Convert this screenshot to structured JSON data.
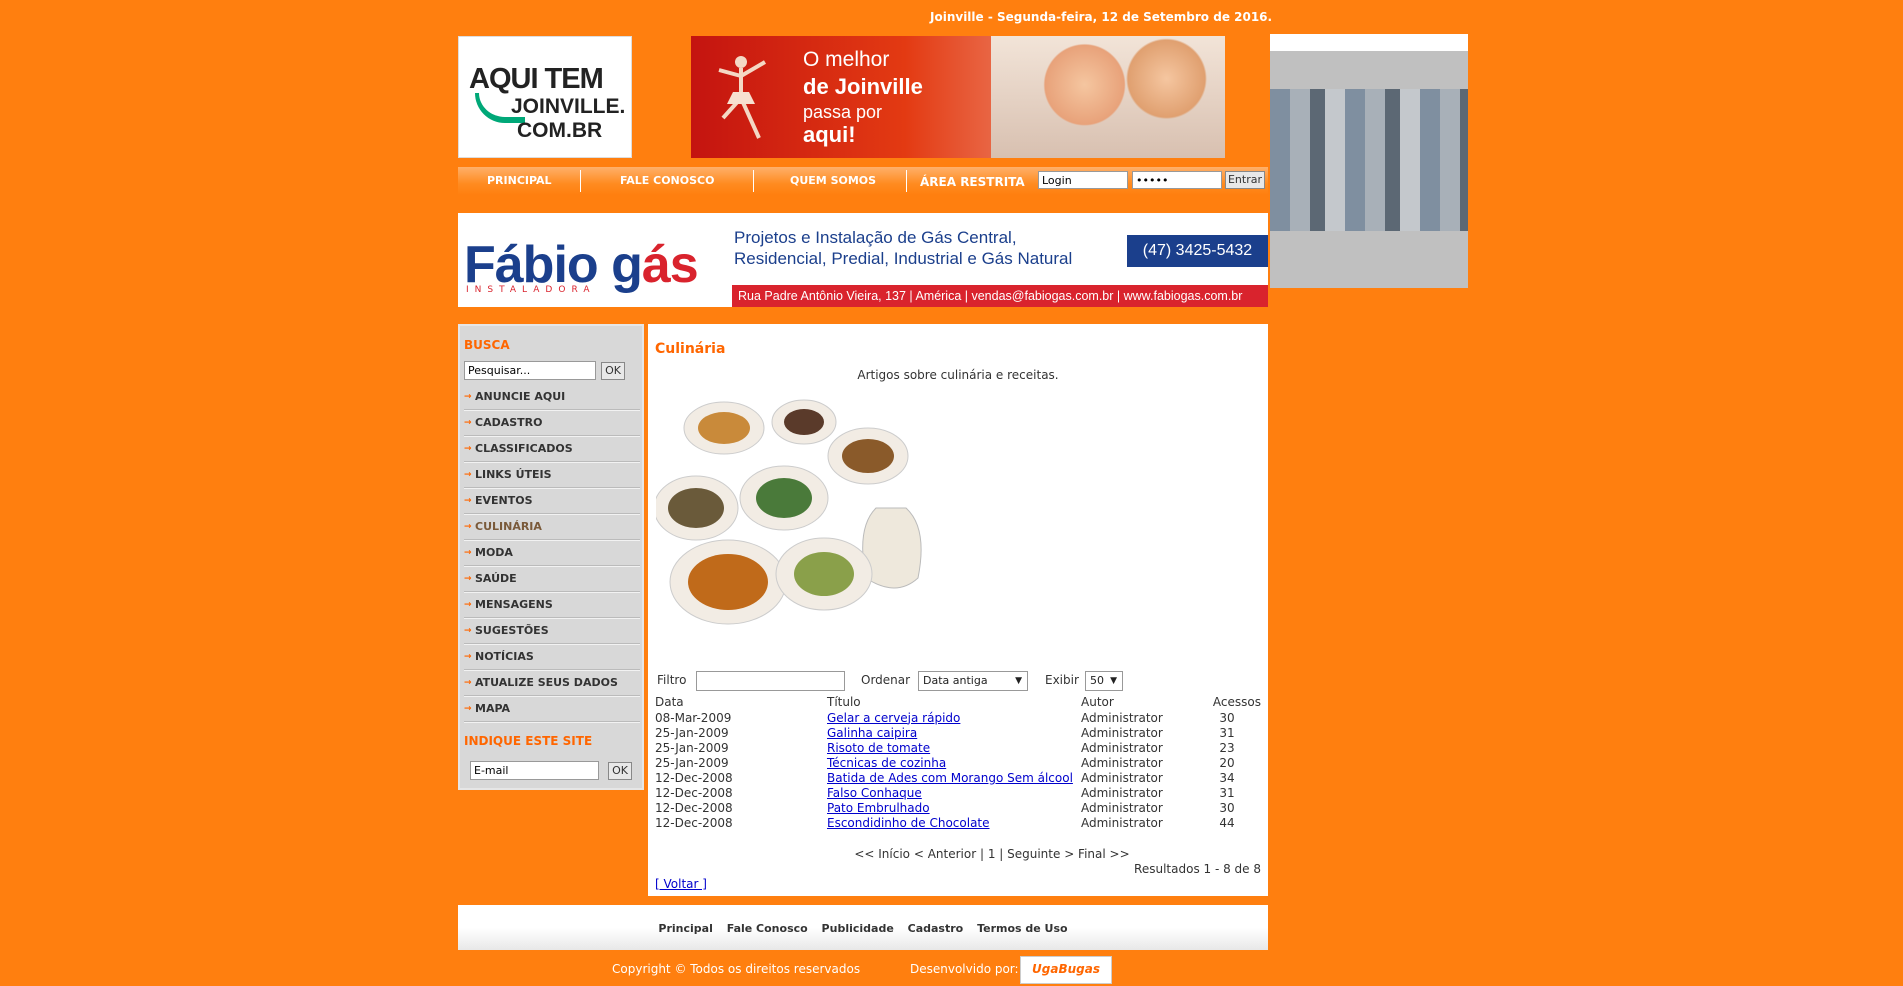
{
  "header": {
    "date": "Joinville - Segunda-feira, 12 de Setembro de 2016.",
    "logo_text": [
      "AQUI TEM",
      "JOINVILLE.",
      "COM.BR"
    ],
    "banner": {
      "line1": "O melhor",
      "line2": "de Joinville",
      "line3": "passa por",
      "line4": "aqui!"
    }
  },
  "nav": {
    "items": [
      "PRINCIPAL",
      "FALE CONOSCO",
      "QUEM SOMOS"
    ],
    "restricted_label": "ÁREA RESTRITA",
    "login_value": "Login",
    "password_value": "•••••",
    "enter_label": "Entrar"
  },
  "ad": {
    "brand": "Fábio g",
    "brand_accent": "ás",
    "brand_sub": "INSTALADORA",
    "desc1": "Projetos e Instalação de Gás Central,",
    "desc2": "Residencial, Predial, Industrial e Gás Natural",
    "phone": "(47) 3425-5432",
    "address": "Rua Padre Antônio Vieira, 137 | América | vendas@fabiogas.com.br | www.fabiogas.com.br"
  },
  "sidebar": {
    "search_heading": "BUSCA",
    "search_value": "Pesquisar...",
    "ok_label": "OK",
    "menu": [
      "ANUNCIE AQUI",
      "CADASTRO",
      "CLASSIFICADOS",
      "LINKS ÚTEIS",
      "EVENTOS",
      "CULINÁRIA",
      "MODA",
      "SAÚDE",
      "MENSAGENS",
      "SUGESTÕES",
      "NOTÍCIAS",
      "ATUALIZE SEUS DADOS",
      "MAPA"
    ],
    "active_index": 5,
    "indique_heading": "INDIQUE ESTE SITE",
    "email_value": "E-mail"
  },
  "content": {
    "title": "Culinária",
    "intro": "Artigos sobre culinária e receitas.",
    "filter_label": "Filtro",
    "order_label": "Ordenar",
    "order_value": "Data antiga",
    "show_label": "Exibir",
    "show_value": "50",
    "columns": [
      "Data",
      "Título",
      "Autor",
      "Acessos"
    ],
    "rows": [
      {
        "date": "08-Mar-2009",
        "title": "Gelar a cerveja rápido",
        "author": "Administrator",
        "hits": "30"
      },
      {
        "date": "25-Jan-2009",
        "title": "Galinha caipira",
        "author": "Administrator",
        "hits": "31"
      },
      {
        "date": "25-Jan-2009",
        "title": "Risoto de tomate",
        "author": "Administrator",
        "hits": "23"
      },
      {
        "date": "25-Jan-2009",
        "title": "Técnicas de cozinha",
        "author": "Administrator",
        "hits": "20"
      },
      {
        "date": "12-Dec-2008",
        "title": "Batida de Ades com Morango Sem álcool",
        "author": "Administrator",
        "hits": "34"
      },
      {
        "date": "12-Dec-2008",
        "title": "Falso Conhaque",
        "author": "Administrator",
        "hits": "31"
      },
      {
        "date": "12-Dec-2008",
        "title": "Pato Embrulhado",
        "author": "Administrator",
        "hits": "30"
      },
      {
        "date": "12-Dec-2008",
        "title": "Escondidinho de Chocolate",
        "author": "Administrator",
        "hits": "44"
      }
    ],
    "pager": "<< Início < Anterior | 1 | Seguinte > Final >>",
    "results": "Resultados 1 - 8 de 8",
    "back": "[ Voltar ]"
  },
  "footer": {
    "links": [
      "Principal",
      "Fale Conosco",
      "Publicidade",
      "Cadastro",
      "Termos de Uso"
    ],
    "copyright": "Copyright © Todos os direitos reservados",
    "developed_by": "Desenvolvido por:",
    "dev_logo": "UgaBugas"
  }
}
